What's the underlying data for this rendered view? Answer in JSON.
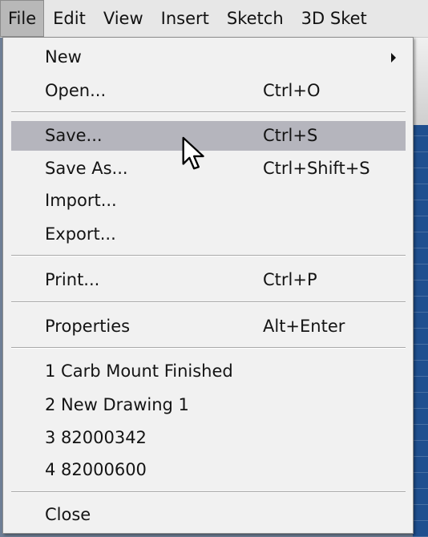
{
  "menubar": {
    "items": [
      "File",
      "Edit",
      "View",
      "Insert",
      "Sketch",
      "3D Sket"
    ],
    "active_index": 0
  },
  "file_menu": {
    "items": [
      {
        "label": "New",
        "shortcut": "",
        "submenu": true
      },
      {
        "label": "Open...",
        "shortcut": "Ctrl+O"
      },
      {
        "label": "Save...",
        "shortcut": "Ctrl+S",
        "highlighted": true
      },
      {
        "label": "Save As...",
        "shortcut": "Ctrl+Shift+S"
      },
      {
        "label": "Import...",
        "shortcut": ""
      },
      {
        "label": "Export...",
        "shortcut": ""
      },
      {
        "label": "Print...",
        "shortcut": "Ctrl+P"
      },
      {
        "label": "Properties",
        "shortcut": "Alt+Enter"
      },
      {
        "label": "1 Carb Mount Finished",
        "shortcut": ""
      },
      {
        "label": "2 New Drawing 1",
        "shortcut": ""
      },
      {
        "label": "3 82000342",
        "shortcut": ""
      },
      {
        "label": "4 82000600",
        "shortcut": ""
      },
      {
        "label": "Close",
        "shortcut": ""
      }
    ]
  },
  "colors": {
    "menu_bg": "#f1f1f1",
    "highlight": "#b5b5bd",
    "menubar_bg": "#e7e7e7",
    "canvas": "#1f4f8f"
  },
  "icons": [
    "submenu-arrow-icon",
    "mouse-pointer-icon"
  ]
}
